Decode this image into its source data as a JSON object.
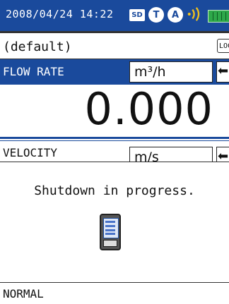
{
  "status_bar": {
    "datetime": "2008/04/24 14:22",
    "sd_label": "SD",
    "icon_t": "T",
    "icon_a": "A",
    "signal_icon": "signal-waves-icon",
    "battery_icon": "battery-icon",
    "accent_color": "#1a4a9c",
    "battery_color": "#2ea84a"
  },
  "profile": {
    "name": "(default)",
    "lock_label": "LOC"
  },
  "flow_rate": {
    "label": "FLOW RATE",
    "unit": "m³/h",
    "value": "0.000",
    "arrow": "⬅"
  },
  "velocity": {
    "label": "VELOCITY",
    "unit": "m/s",
    "arrow": "⬅"
  },
  "dialog": {
    "message": "Shutdown in progress.",
    "icon": "handheld-device-icon"
  },
  "footer": {
    "mode": "NORMAL"
  }
}
